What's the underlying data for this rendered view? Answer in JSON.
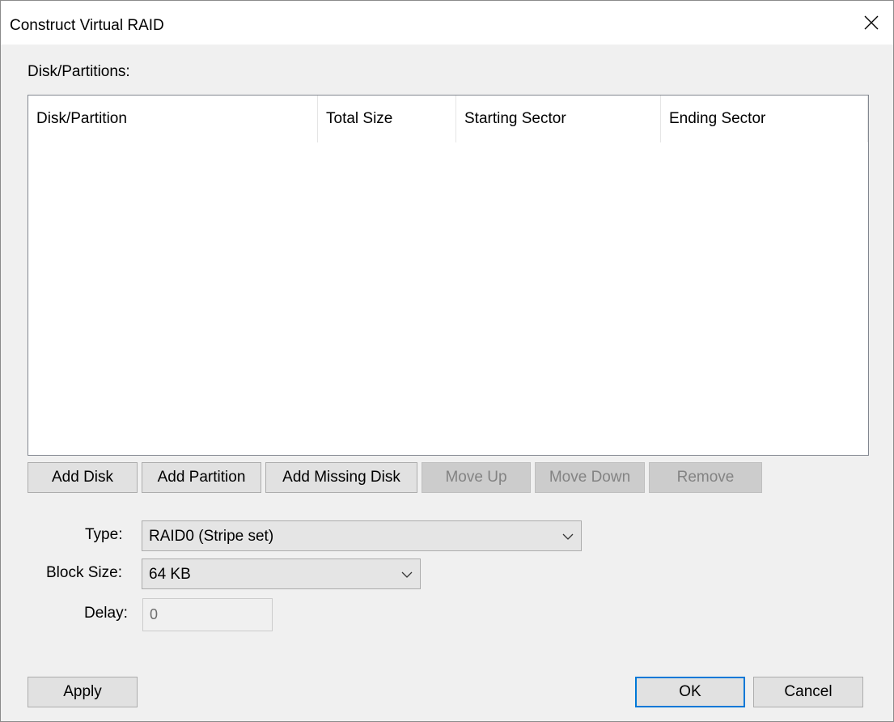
{
  "window": {
    "title": "Construct Virtual RAID"
  },
  "list": {
    "label": "Disk/Partitions:",
    "columns": [
      "Disk/Partition",
      "Total Size",
      "Starting Sector",
      "Ending Sector"
    ]
  },
  "toolbar": {
    "add_disk": "Add Disk",
    "add_partition": "Add Partition",
    "add_missing_disk": "Add Missing Disk",
    "move_up": "Move Up",
    "move_down": "Move Down",
    "remove": "Remove"
  },
  "form": {
    "type_label": "Type:",
    "type_value": "RAID0 (Stripe set)",
    "block_size_label": "Block Size:",
    "block_size_value": "64 KB",
    "delay_label": "Delay:",
    "delay_value": "0"
  },
  "footer": {
    "apply": "Apply",
    "ok": "OK",
    "cancel": "Cancel"
  },
  "icons": {
    "close": "close-icon",
    "dropdown": "chevron-down-icon"
  },
  "colors": {
    "default_button_border": "#0078d7",
    "disabled_text": "#838383"
  }
}
